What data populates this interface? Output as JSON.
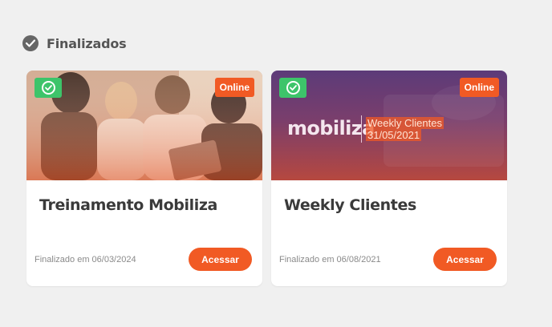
{
  "section": {
    "title": "Finalizados",
    "icon": "check-circle-icon"
  },
  "cards": [
    {
      "title": "Treinamento Mobiliza",
      "badge": "Online",
      "status_icon": "check-icon",
      "finalized_text": "Finalizado em 06/03/2024",
      "button_label": "Acessar",
      "image": "group-of-people-photo"
    },
    {
      "title": "Weekly Clientes",
      "badge": "Online",
      "status_icon": "check-icon",
      "finalized_text": "Finalizado em 06/08/2021",
      "button_label": "Acessar",
      "banner": {
        "logo": "mobiliza",
        "event_name": "Weekly Clientes",
        "event_date": "31/05/2021"
      }
    }
  ],
  "colors": {
    "accent": "#f15a24",
    "success": "#3dc46a",
    "background": "#f0f0f0"
  }
}
